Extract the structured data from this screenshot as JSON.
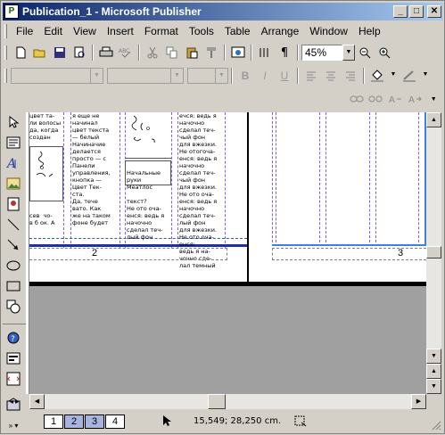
{
  "window": {
    "title": "Publication_1 - Microsoft Publisher",
    "app_icon_letter": "P",
    "minimize": "_",
    "maximize": "□",
    "close": "✕"
  },
  "menu": {
    "items": [
      "File",
      "Edit",
      "View",
      "Insert",
      "Format",
      "Tools",
      "Table",
      "Arrange",
      "Window",
      "Help"
    ]
  },
  "standard_toolbar": {
    "zoom_value": "45%",
    "icons": [
      "new-icon",
      "open-icon",
      "save-icon",
      "search-files-icon",
      "print-icon",
      "spelling-icon",
      "cut-icon",
      "copy-icon",
      "paste-icon",
      "format-painter-icon",
      "web-preview-icon",
      "columns-icon",
      "show-special-characters-icon",
      "zoom-out-icon",
      "zoom-in-icon"
    ]
  },
  "formatting_toolbar": {
    "bold": "B",
    "italic": "I",
    "underline": "U"
  },
  "pages": {
    "left_page_number": "2",
    "right_page_number": "3",
    "col1_text": "цвет та-\nли волосы\nда, когда\nсоздан\n\n\n\n\n\n\n\n\n\n\nсев  чо-\nв б ок. А",
    "col2_text": "я еще не\nначинал\nцвет текста\n— белый\nНачиначие\nделается\nпросто — с\nПанели\nуправления,\nкнопка —\nЦвет Тек-\nста.\nДа, тече\nвато. Как\nже на таком\nфоне будет",
    "col3_text": "\n\n\n\n\n\n\n\nНачальные\nруки\nМеатлос\n\nтекст?\nНе ото оча-\nенся: ведь я\nначочно\nсделал теч-\nлый фон",
    "col4_text": "ечся: ведь я\nначочно\nсделал теч-\nчый фон\nдля вжезки.\nНе отогоча-\nенся: ведь я\nначочно\nсделал теч-\nчый фон\nдля вжезки.\nНе ото оча-\nенся: ведь я\nначочно\nсделал теч-\nлый фон\nдля вжезки.\nНе ото оча-\nенся:\nведь я на-\nчочно сде-\nлал темный"
  },
  "status": {
    "page_tabs": [
      "1",
      "2",
      "3",
      "4"
    ],
    "active_tabs": [
      "2",
      "3"
    ],
    "position": "15,549; 28,250 cm."
  },
  "colors": {
    "title_gradient_start": "#0a246a",
    "title_gradient_end": "#a6caf0",
    "page_tab_active": "#a8b4e0",
    "guide_purple": "#7b5cff",
    "guide_blue": "#3355cc"
  }
}
